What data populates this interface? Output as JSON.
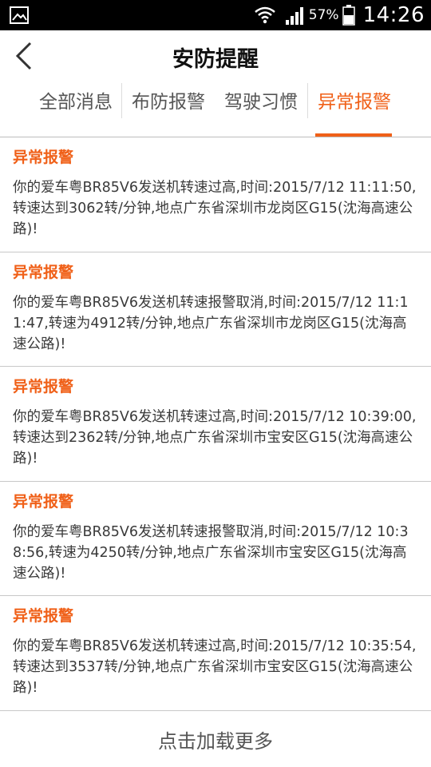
{
  "status_bar": {
    "battery_percent": "57%",
    "time": "14:26",
    "icons": [
      "gallery-icon",
      "wifi-icon",
      "signal-icon",
      "battery-icon"
    ]
  },
  "header": {
    "title": "安防提醒",
    "back_icon": "chevron-left-icon"
  },
  "tabs": [
    {
      "label": "全部消息",
      "active": false
    },
    {
      "label": "布防报警",
      "active": false
    },
    {
      "label": "驾驶习惯",
      "active": false
    },
    {
      "label": "异常报警",
      "active": true
    }
  ],
  "messages": [
    {
      "title": "异常报警",
      "body": "你的爱车粤BR85V6发送机转速过高,时间:2015/7/12 11:11:50,转速达到3062转/分钟,地点广东省深圳市龙岗区G15(沈海高速公路)!"
    },
    {
      "title": "异常报警",
      "body": "你的爱车粤BR85V6发送机转速报警取消,时间:2015/7/12 11:11:47,转速为4912转/分钟,地点广东省深圳市龙岗区G15(沈海高速公路)!"
    },
    {
      "title": "异常报警",
      "body": "你的爱车粤BR85V6发送机转速过高,时间:2015/7/12 10:39:00,转速达到2362转/分钟,地点广东省深圳市宝安区G15(沈海高速公路)!"
    },
    {
      "title": "异常报警",
      "body": "你的爱车粤BR85V6发送机转速报警取消,时间:2015/7/12 10:38:56,转速为4250转/分钟,地点广东省深圳市宝安区G15(沈海高速公路)!"
    },
    {
      "title": "异常报警",
      "body": "你的爱车粤BR85V6发送机转速过高,时间:2015/7/12 10:35:54,转速达到3537转/分钟,地点广东省深圳市宝安区G15(沈海高速公路)!"
    }
  ],
  "load_more": {
    "label": "点击加载更多"
  },
  "colors": {
    "accent": "#f06018",
    "status_bar_bg": "#000000",
    "divider": "#c8c8c8",
    "body_text": "#3a3a3a"
  }
}
